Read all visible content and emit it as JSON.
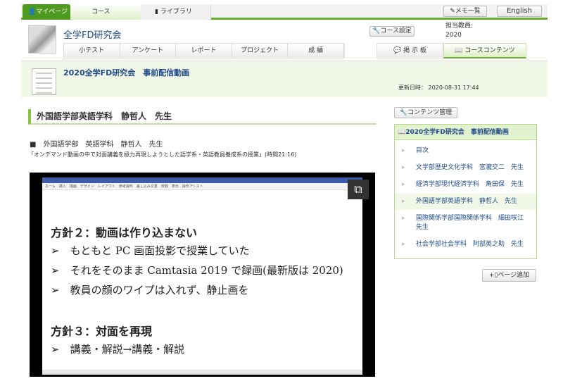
{
  "topbar": {
    "tabs": [
      {
        "label": "マイページ",
        "icon": "person-icon"
      },
      {
        "label": "コース",
        "icon": "class-icon"
      },
      {
        "label": "ライブラリ",
        "icon": "book-icon"
      }
    ],
    "memo_label": "メモ一覧",
    "english_label": "English"
  },
  "course": {
    "title": "全学FD研究会",
    "settings_label": "コース設定",
    "teacher_label": "担当教員:",
    "teacher_value": "2020",
    "nav": [
      "小テスト",
      "アンケート",
      "レポート",
      "プロジェクト",
      "成 績"
    ],
    "board_label": "掲 示 板",
    "contents_label": "コースコンテンツ"
  },
  "page": {
    "title": "2020全学FD研究会　事前配信動画",
    "updated_label": "更新日時：",
    "updated_value": "2020-08-31 17:44"
  },
  "main": {
    "section_title": "外国語学部英語学科　静哲人　先生",
    "subhead": "■　外国語学部　英語学科　静哲人　先生",
    "description": "「オンデマンド動画の中で対面講義を極力再現しようとした語学系・英語教員養成系の授業」(時間21:16)",
    "video": {
      "ribbon": "ホーム　挿入　描画　デザイン　レイアウト　参考資料　差し込み文書　校閲　表示　操作アシスト",
      "lines": [
        "方針２：動画は作り込まない",
        "➢　もともと PC 画面投影で授業していた",
        "➢　それをそのまま Camtasia 2019 で録画(最新版は 2020)",
        "➢　教員の顔のワイプは入れず、静止画を",
        "方針３：対面を再現",
        "➢　講義・解説→講義・解説"
      ]
    }
  },
  "sidebar": {
    "manage_label": "コンテンツ管理",
    "heading": "2020全学FD研究会　事前配信動画",
    "items": [
      "目次",
      "文学部歴史文化学科　宮瀧交二　先生",
      "経済学部現代経済学科　角田保　先生",
      "外国語学部英語学科　静哲人　先生",
      "国際関係学部国際関係学科　細田咲江　先生",
      "社会学部社会学科　阿部英之助　先生"
    ],
    "active_index": 3,
    "add_page_label": "ページ追加"
  },
  "colors": {
    "accent": "#6aab2e",
    "link": "#1c4a8a",
    "band": "#f2f8e8"
  }
}
